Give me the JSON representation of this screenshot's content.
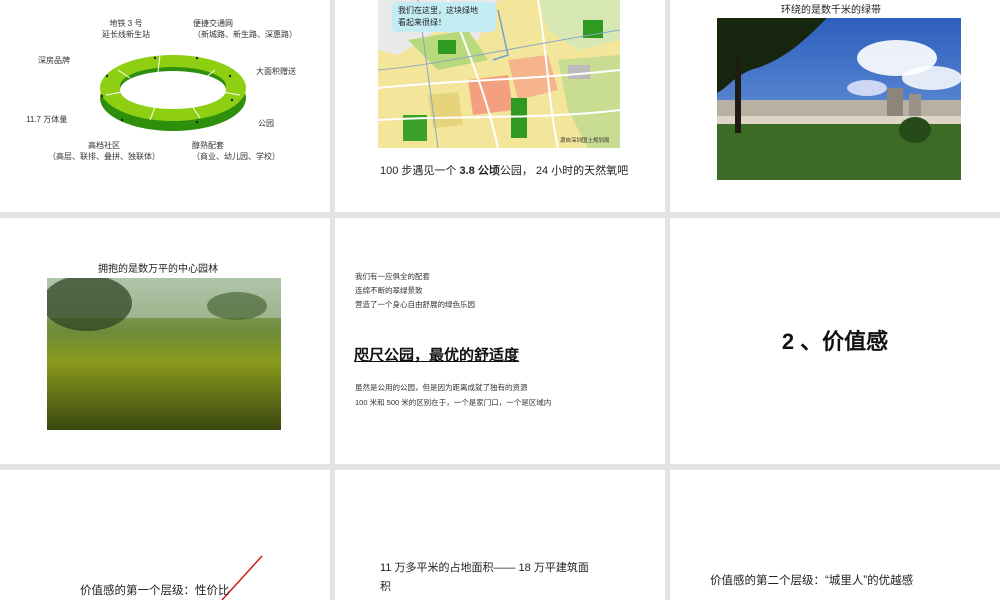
{
  "slide1": {
    "labels": {
      "metro": "地铁 3 号\n延长线新生站",
      "traffic": "便捷交通网\n（新城路、新生路、深惠路）",
      "brand": "深房品牌",
      "gift": "大面积赠送",
      "volume": "11.7 万体量",
      "park": "公园",
      "community": "高档社区\n（高层、联排、叠拼、独联体）",
      "facilities": "醇熟配套\n（商业、幼儿园、学校）"
    }
  },
  "slide2": {
    "bubble": "我们在这里，这块绿地\n看起来很绿！",
    "map_source": "源自深圳国土规划局",
    "caption_pre": "100 步遇见一个 ",
    "caption_bold": "3.8 公顷",
    "caption_post": "公园， 24 小时的天然氧吧"
  },
  "slide3": {
    "title": "环绕的是数千米的绿带"
  },
  "slide4": {
    "title": "拥抱的是数万平的中心园林"
  },
  "slide5": {
    "line1": "我们有一应俱全的配套",
    "line2": "连绵不断的翠绿景致",
    "line3": "营造了一个身心自由舒展的绿色乐园",
    "heading": "咫尺公园，最优的舒适度",
    "body1": "虽然是公用的公园，但是因为距离成就了独有的资源",
    "body2": "100 米和 500 米的区别在于，一个是家门口，一个是区域内"
  },
  "slide6": {
    "title": "2 、价值感"
  },
  "slide7": {
    "text": "价值感的第一个层级：性价比"
  },
  "slide8": {
    "line1": "11 万多平米的占地面积—— 18 万平建筑面",
    "line2": "积"
  },
  "slide9": {
    "text": "价值感的第二个层级：“城里人”的优越感"
  }
}
